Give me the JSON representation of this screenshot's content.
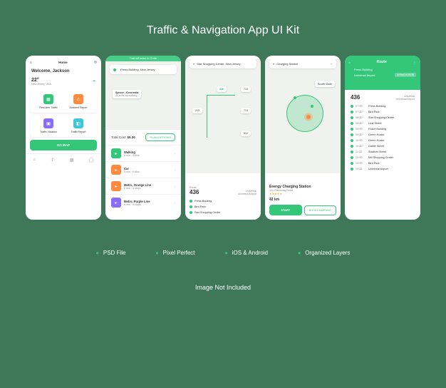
{
  "title": "Traffic & Navigation App UI Kit",
  "features": [
    "PSD File",
    "Pixel Perfect",
    "iOS & Android",
    "Organized Layers"
  ],
  "footer": "Image Not Included",
  "s1": {
    "header": "Home",
    "welcome": "Welcome, Jackson",
    "temp": "22°",
    "loc": "New Jersey, USA",
    "tiles": [
      {
        "label": "Real-time Traffic"
      },
      {
        "label": "Accident Report"
      },
      {
        "label": "Traffic Violation"
      },
      {
        "label": "Traffic Report"
      }
    ],
    "cta": "GO MAP"
  },
  "s2": {
    "eta_label": "Train will arrive in",
    "eta": "10 min",
    "search": "Press Building, New Jersey",
    "spruce": "Spruce - Concordia",
    "spruce_sub": "22 mins by walking",
    "cost_label": "Total Cost:",
    "cost": "$5.30",
    "plan": "PLAN OPTIONS",
    "modes": [
      {
        "name": "Walking",
        "sub": "8 min · 0.6km"
      },
      {
        "name": "Car",
        "sub": "3 min · 0.6km"
      },
      {
        "name": "Metro, Orange Line",
        "sub": "6 min · 4 stops"
      },
      {
        "name": "Metro, Purple Line",
        "sub": "6 min · 4 stops"
      }
    ]
  },
  "s3": {
    "search": "Star Shopping Center, New Jersey",
    "route_num": "436",
    "route_label": "Route",
    "from": "Universal",
    "to": "Universal Airport",
    "pins": [
      "436",
      "713",
      "213",
      "713",
      "512"
    ],
    "stops": [
      "Press Building",
      "Bird Park",
      "Star Shopping Center"
    ]
  },
  "s4": {
    "search": "Charging Station",
    "title": "Energy Charging Station",
    "addr": "431 Greenway Road",
    "dist": "42 km",
    "rating": "★★★★★",
    "start": "START",
    "book": "BOOK CHARGING",
    "area": "South Gate"
  },
  "s5": {
    "header": "Route",
    "from": "Press Building",
    "to": "Universal Airport",
    "arrive": "Arrived at 19:36",
    "route_num": "436",
    "from2": "Universal",
    "to2": "Universal Airport",
    "stops": [
      {
        "t": "07:00",
        "n": "Press Building"
      },
      {
        "t": "07:30",
        "n": "Bird Park"
      },
      {
        "t": "08:30",
        "n": "Star Shopping Center"
      },
      {
        "t": "08:30",
        "n": "Leaf Street"
      },
      {
        "t": "09:00",
        "n": "Police Building"
      },
      {
        "t": "09:30",
        "n": "Green Hostel"
      },
      {
        "t": "10:00",
        "n": "Green Hostel"
      },
      {
        "t": "10:30",
        "n": "Castle Street"
      },
      {
        "t": "11:30",
        "n": "Stadium Street"
      },
      {
        "t": "12:00",
        "n": "Mill Shopping Center"
      },
      {
        "t": "19:00",
        "n": "Bird Park"
      },
      {
        "t": "19:36",
        "n": "Universal Airport"
      }
    ]
  }
}
